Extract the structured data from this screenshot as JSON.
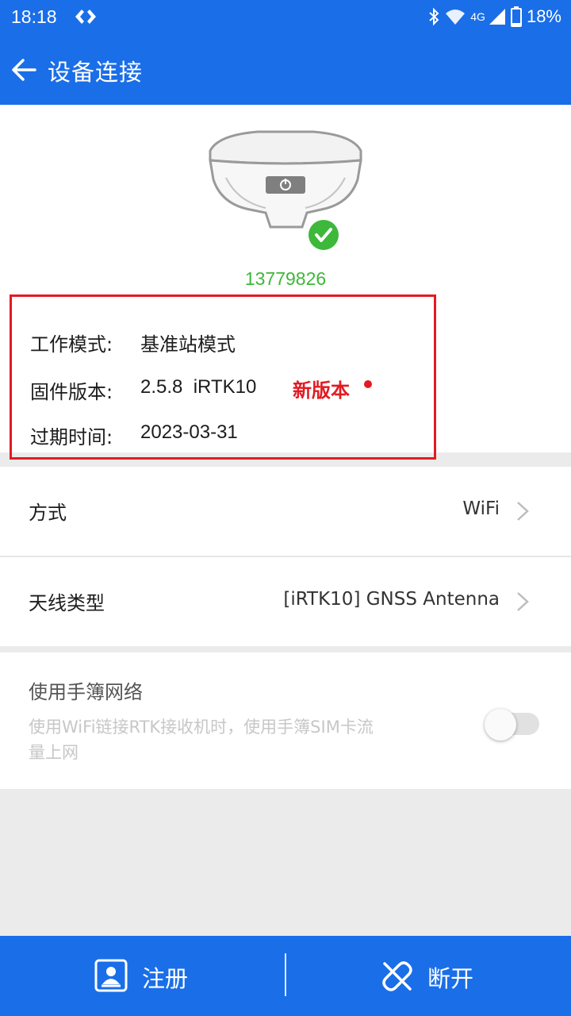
{
  "status_bar": {
    "time": "18:18",
    "network": "4G",
    "battery": "18%",
    "icons": [
      "developer-icon",
      "bluetooth-icon",
      "wifi-icon",
      "signal-icon",
      "battery-icon"
    ]
  },
  "header": {
    "title": "设备连接",
    "back_icon": "back-arrow-icon"
  },
  "device": {
    "serial": "13779826",
    "connected": true,
    "info": {
      "work_mode_label": "工作模式:",
      "work_mode_value": "基准站模式",
      "firmware_label": "固件版本:",
      "firmware_value": "2.5.8  iRTK10",
      "new_version_label": "新版本",
      "expiry_label": "过期时间:",
      "expiry_value": "2023-03-31"
    }
  },
  "settings": {
    "method_label": "方式",
    "method_value": "WiFi",
    "antenna_label": "天线类型",
    "antenna_value": "[iRTK10] GNSS Antenna",
    "network_title": "使用手簿网络",
    "network_desc": "使用WiFi链接RTK接收机时，使用手簿SIM卡流量上网",
    "network_enabled": false
  },
  "actions": {
    "register_label": "注册",
    "disconnect_label": "断开"
  },
  "colors": {
    "primary": "#1a6ee8",
    "success": "#3db83a",
    "alert": "#e21b22"
  }
}
